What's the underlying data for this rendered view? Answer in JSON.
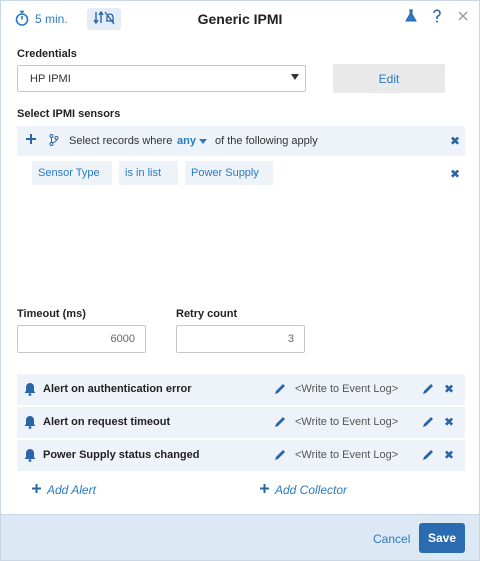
{
  "header": {
    "timer_label": "5 min.",
    "title": "Generic IPMI",
    "icons": [
      "stopwatch-icon",
      "mute-sort-icon",
      "flask-icon",
      "help-icon",
      "close-icon"
    ]
  },
  "credentials": {
    "label": "Credentials",
    "selected": "HP IPMI",
    "edit_label": "Edit"
  },
  "sensors": {
    "label": "Select IPMI sensors",
    "filter_prefix": "Select records where",
    "match_mode": "any",
    "filter_suffix": "of the following apply",
    "conditions": [
      {
        "field": "Sensor Type",
        "operator": "is in list",
        "value": "Power Supply"
      }
    ]
  },
  "timeout": {
    "label": "Timeout (ms)",
    "value": "6000"
  },
  "retry": {
    "label": "Retry count",
    "value": "3"
  },
  "alerts": [
    {
      "name": "Alert on authentication error",
      "target": "<Write to Event Log>"
    },
    {
      "name": "Alert on request timeout",
      "target": "<Write to Event Log>"
    },
    {
      "name": "Power Supply status changed",
      "target": "<Write to Event Log>"
    }
  ],
  "add_alert_label": "Add Alert",
  "add_collector_label": "Add Collector",
  "footer": {
    "cancel_label": "Cancel",
    "save_label": "Save"
  },
  "colors": {
    "accent": "#2a7bc4",
    "row_bg": "#eef3f9",
    "footer_bg": "#dde8f5",
    "save_bg": "#2b6cb0"
  }
}
